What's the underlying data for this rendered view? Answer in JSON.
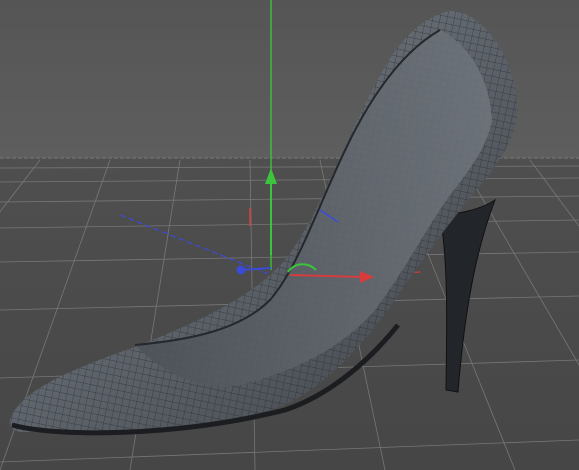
{
  "viewport": {
    "type": "3d-perspective-viewport",
    "background_sky": "#5a5a5a",
    "background_floor": "#4b4b4b",
    "grid_color": "#8c8c8c",
    "grid_visible": true
  },
  "axis_gizmo": {
    "x_axis_color": "#d63c3c",
    "y_axis_color": "#3cc43c",
    "z_axis_color": "#3c4bd6"
  },
  "model": {
    "object": "high-heel-shoe",
    "display": "wireframe-shaded",
    "surface_color": "#646a72",
    "wire_color": "#2a2d31"
  }
}
